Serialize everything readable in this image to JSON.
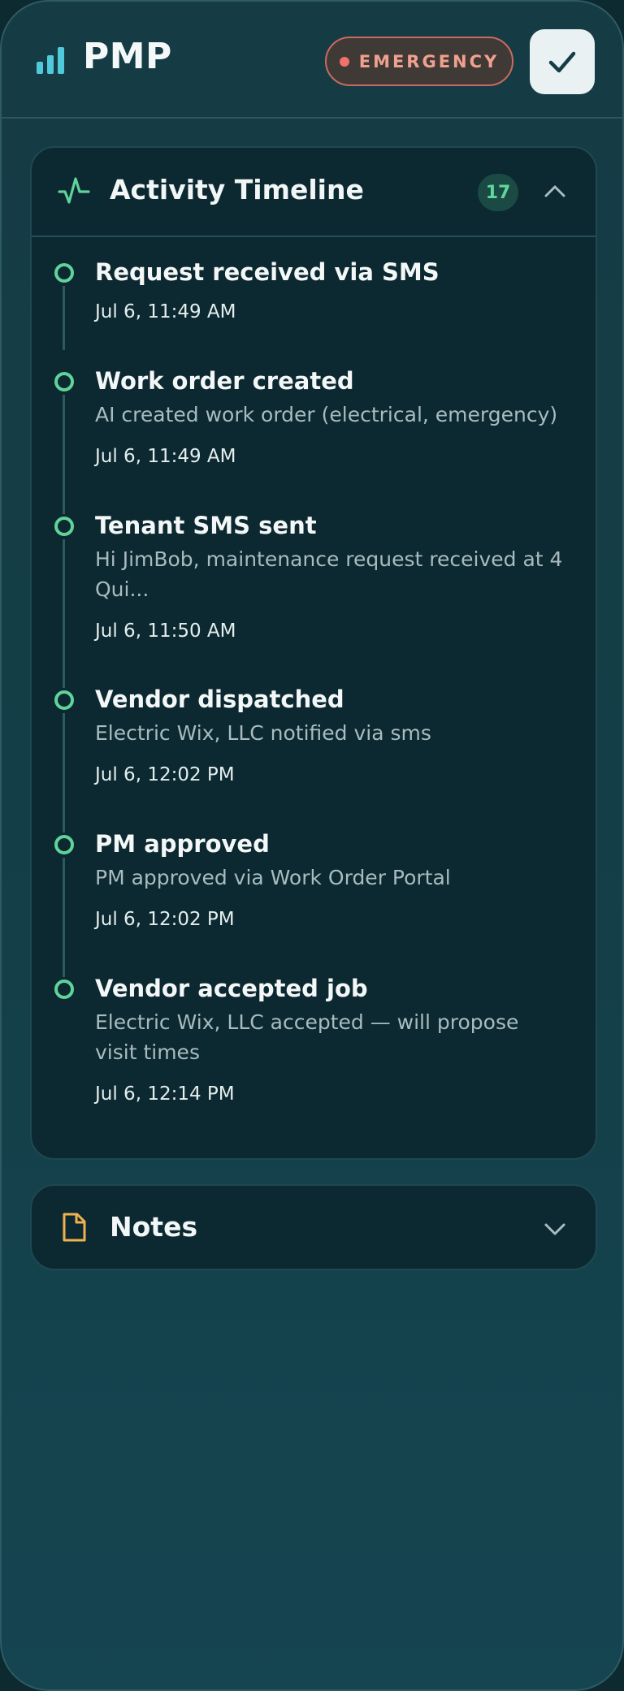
{
  "header": {
    "app_name": "PMP",
    "priority_badge": "EMERGENCY"
  },
  "colors": {
    "accent": "#5fd39a",
    "emergency": "#f0736a",
    "background": "#153c45",
    "notes_icon": "#f0b24e"
  },
  "icons": {
    "logo": "bar-chart-icon",
    "confirm": "checkmark-icon",
    "timeline": "activity-pulse-icon",
    "notes": "document-icon",
    "collapse": "chevron-up-icon",
    "expand": "chevron-down-icon"
  },
  "timeline": {
    "title": "Activity Timeline",
    "count": "17",
    "events": [
      {
        "title": "Request received via SMS",
        "description": "",
        "time": "Jul 6, 11:49 AM"
      },
      {
        "title": "Work order created",
        "description": "AI created work order (electrical, emergency)",
        "time": "Jul 6, 11:49 AM"
      },
      {
        "title": "Tenant SMS sent",
        "description": "Hi JimBob, maintenance request received at 4 Qui...",
        "time": "Jul 6, 11:50 AM"
      },
      {
        "title": "Vendor dispatched",
        "description": "Electric Wix, LLC notified via sms",
        "time": "Jul 6, 12:02 PM"
      },
      {
        "title": "PM approved",
        "description": "PM approved via Work Order Portal",
        "time": "Jul 6, 12:02 PM"
      },
      {
        "title": "Vendor accepted job",
        "description": "Electric Wix, LLC accepted — will propose visit times",
        "time": "Jul 6, 12:14 PM"
      }
    ]
  },
  "notes": {
    "title": "Notes"
  }
}
